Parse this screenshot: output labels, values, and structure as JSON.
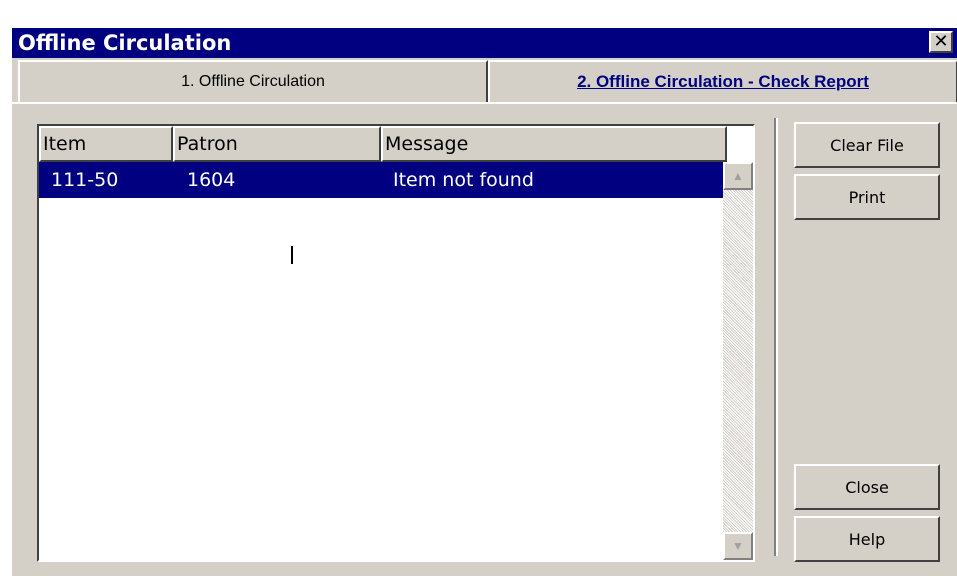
{
  "window": {
    "title": "Offline Circulation",
    "close_glyph": "✕"
  },
  "tabs": [
    {
      "label": "1. Offline Circulation"
    },
    {
      "label": "2. Offline Circulation - Check Report"
    }
  ],
  "list": {
    "columns": [
      "Item",
      "Patron",
      "Message"
    ],
    "rows": [
      {
        "item": "111-50",
        "patron": "1604",
        "message": "Item not found"
      }
    ]
  },
  "buttons": {
    "clear_file": "Clear File",
    "print": "Print",
    "close": "Close",
    "help": "Help"
  },
  "colors": {
    "titlebar": "#000080",
    "selection": "#000080",
    "face": "#d4d0c8"
  }
}
